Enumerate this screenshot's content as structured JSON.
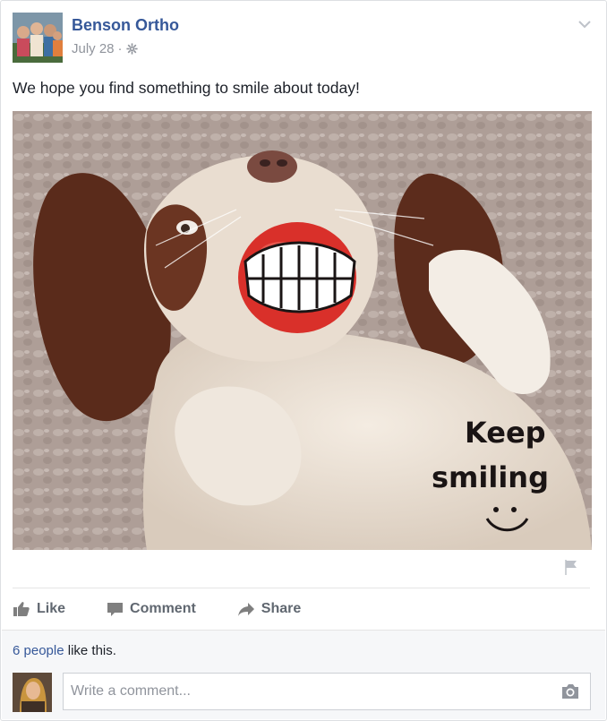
{
  "post": {
    "author": "Benson Ortho",
    "date": "July 28",
    "separator": "·",
    "privacy_icon": "gear-globe-icon",
    "text": "We hope you find something to smile about today!",
    "image_caption": "Keep smiling"
  },
  "actions": {
    "like": "Like",
    "comment": "Comment",
    "share": "Share"
  },
  "footer": {
    "likes_people": "6 people",
    "likes_suffix": " like this.",
    "comment_placeholder": "Write a comment..."
  },
  "colors": {
    "link_blue": "#365899",
    "meta_gray": "#90949c",
    "action_gray": "#606770",
    "footer_bg": "#f6f7f9"
  }
}
